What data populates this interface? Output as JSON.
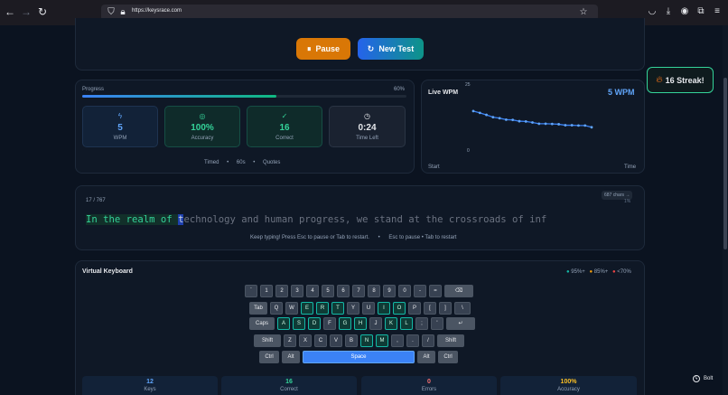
{
  "browser": {
    "url": "https://keysrace.com"
  },
  "controls": {
    "pause_label": "Pause",
    "new_test_label": "New Test"
  },
  "streak": {
    "label": "16 Streak!"
  },
  "progress": {
    "label": "Progress",
    "percent_text": "60%",
    "percent": 60
  },
  "stats": [
    {
      "value": "5",
      "label": "WPM",
      "color": "#60a5fa",
      "icon": "lightning-icon"
    },
    {
      "value": "100%",
      "label": "Accuracy",
      "color": "#34d399",
      "icon": "target-icon"
    },
    {
      "value": "16",
      "label": "Correct",
      "color": "#34d399",
      "icon": "check-circle-icon"
    },
    {
      "value": "0:24",
      "label": "Time Left",
      "color": "#e5e7eb",
      "icon": "clock-icon"
    }
  ],
  "mode": {
    "timed": "Timed",
    "duration": "60s",
    "content": "Quotes"
  },
  "live_wpm": {
    "title": "Live WPM",
    "value_text": "5 WPM",
    "y_top": "25",
    "y_bottom": "0",
    "x_start": "Start",
    "x_end": "Time"
  },
  "chart_data": {
    "type": "line",
    "title": "Live WPM",
    "xlabel": "Time",
    "ylim": [
      0,
      25
    ],
    "x_labels": [
      "Start",
      "Time"
    ],
    "series": [
      {
        "values": [
          15.4,
          14.7,
          13.9,
          13.0,
          12.6,
          12.0,
          11.9,
          11.4,
          11.3,
          10.9,
          10.4,
          10.4,
          10.3,
          10.2,
          9.8,
          9.8,
          9.7,
          9.7,
          9.0
        ]
      }
    ]
  },
  "text_area": {
    "counter": "17 / 767",
    "chars_badge": "687 chars →",
    "pct": "1%",
    "typed": "In the realm of ",
    "current": "t",
    "remaining": "echnology and human progress, we stand at the crossroads of inf",
    "hint": "Keep typing! Press Esc to pause or Tab to restart.",
    "hint2": "Esc to pause • Tab to restart"
  },
  "keyboard": {
    "title": "Virtual Keyboard",
    "legend": [
      "95%+",
      "85%+",
      "<70%"
    ],
    "rows": [
      [
        "`",
        "1",
        "2",
        "3",
        "4",
        "5",
        "6",
        "7",
        "8",
        "9",
        "0",
        "-",
        "=",
        "⌫"
      ],
      [
        "Tab",
        "Q",
        "W",
        "E",
        "R",
        "T",
        "Y",
        "U",
        "I",
        "O",
        "P",
        "[",
        "]",
        "\\"
      ],
      [
        "Caps",
        "A",
        "S",
        "D",
        "F",
        "G",
        "H",
        "J",
        "K",
        "L",
        ";",
        "'",
        "↵"
      ],
      [
        "Shift",
        "Z",
        "X",
        "C",
        "V",
        "B",
        "N",
        "M",
        ",",
        ".",
        "/",
        "Shift"
      ],
      [
        "Ctrl",
        "Alt",
        "Space",
        "Alt",
        "Ctrl"
      ]
    ]
  },
  "bottom_stats": [
    {
      "value": "12",
      "label": "Keys",
      "color": "#60a5fa"
    },
    {
      "value": "16",
      "label": "Correct",
      "color": "#34d399"
    },
    {
      "value": "0",
      "label": "Errors",
      "color": "#f87171"
    },
    {
      "value": "100%",
      "label": "Accuracy",
      "color": "#fbbf24"
    }
  ],
  "bolt": {
    "label": "Bolt"
  }
}
